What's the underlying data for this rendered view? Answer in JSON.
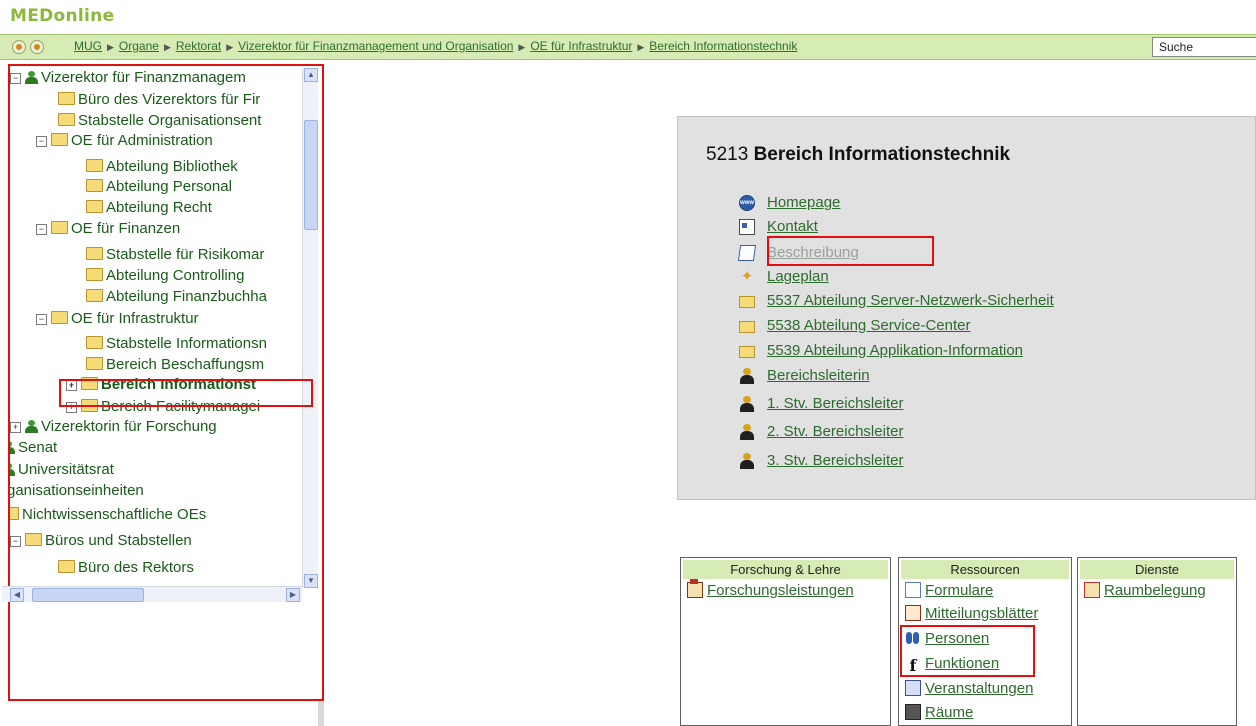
{
  "app": {
    "logo": "MEDonline"
  },
  "navbar": {
    "breadcrumbs": [
      "MUG",
      "Organe",
      "Rektorat",
      "Vizerektor für Finanzmanagement und Organisation",
      "OE für Infrastruktur",
      "Bereich Informationstechnik"
    ],
    "separator": "▶",
    "search_label": "Suche"
  },
  "tree": {
    "items": [
      {
        "label": "Vizerektor für Finanzmanagem",
        "expander": "−"
      },
      {
        "label": "Büro des Vizerektors für Fir"
      },
      {
        "label": "Stabstelle Organisationsent"
      },
      {
        "label": "OE für Administration",
        "expander": "−"
      },
      {
        "label": "Abteilung Bibliothek"
      },
      {
        "label": "Abteilung Personal"
      },
      {
        "label": "Abteilung Recht"
      },
      {
        "label": "OE für Finanzen",
        "expander": "−"
      },
      {
        "label": "Stabstelle für Risikomar"
      },
      {
        "label": "Abteilung Controlling"
      },
      {
        "label": "Abteilung Finanzbuchha"
      },
      {
        "label": "OE für Infrastruktur",
        "expander": "−"
      },
      {
        "label": "Stabstelle Informationsn"
      },
      {
        "label": "Bereich Beschaffungsm"
      },
      {
        "label": "Bereich Informationst",
        "expander": "+",
        "selected": true
      },
      {
        "label": "Bereich Facilitymanagei",
        "expander": "+"
      },
      {
        "label": "Vizerektorin für Forschung",
        "expander": "+"
      },
      {
        "label": "Senat"
      },
      {
        "label": "Universitätsrat"
      },
      {
        "label": "rganisationseinheiten"
      },
      {
        "label": "Nichtwissenschaftliche OEs"
      },
      {
        "label": "Büros und Stabstellen",
        "expander": "−"
      },
      {
        "label": "Büro des Rektors"
      }
    ]
  },
  "info": {
    "number": "5213",
    "title": "Bereich Informationstechnik",
    "links": [
      {
        "label": "Homepage",
        "icon": "www-globe-icon"
      },
      {
        "label": "Kontakt",
        "icon": "contact-card-icon"
      },
      {
        "label": "Beschreibung",
        "icon": "description-icon",
        "disabled": true
      },
      {
        "label": "Lageplan",
        "icon": "map-pin-icon"
      },
      {
        "label": "5537 Abteilung Server-Netzwerk-Sicherheit",
        "icon": "folder-icon"
      },
      {
        "label": "5538 Abteilung Service-Center",
        "icon": "folder-icon"
      },
      {
        "label": "5539 Abteilung Applikation-Information",
        "icon": "folder-icon"
      },
      {
        "label": "Bereichsleiterin",
        "icon": "person-icon"
      },
      {
        "label": "1. Stv. Bereichsleiter",
        "icon": "person-icon"
      },
      {
        "label": "2. Stv. Bereichsleiter",
        "icon": "person-icon"
      },
      {
        "label": "3. Stv. Bereichsleiter",
        "icon": "person-icon"
      }
    ]
  },
  "panels": {
    "research": {
      "title": "Forschung & Lehre",
      "items": [
        "Forschungsleistungen"
      ]
    },
    "resources": {
      "title": "Ressourcen",
      "items": [
        "Formulare",
        "Mitteilungsblätter",
        "Personen",
        "Funktionen",
        "Veranstaltungen",
        "Räume"
      ]
    },
    "services": {
      "title": "Dienste",
      "items": [
        "Raumbelegung"
      ]
    }
  },
  "colors": {
    "accent_green": "#d7ebb4",
    "link_green": "#2e6b2e",
    "highlight_red": "#e01010"
  }
}
